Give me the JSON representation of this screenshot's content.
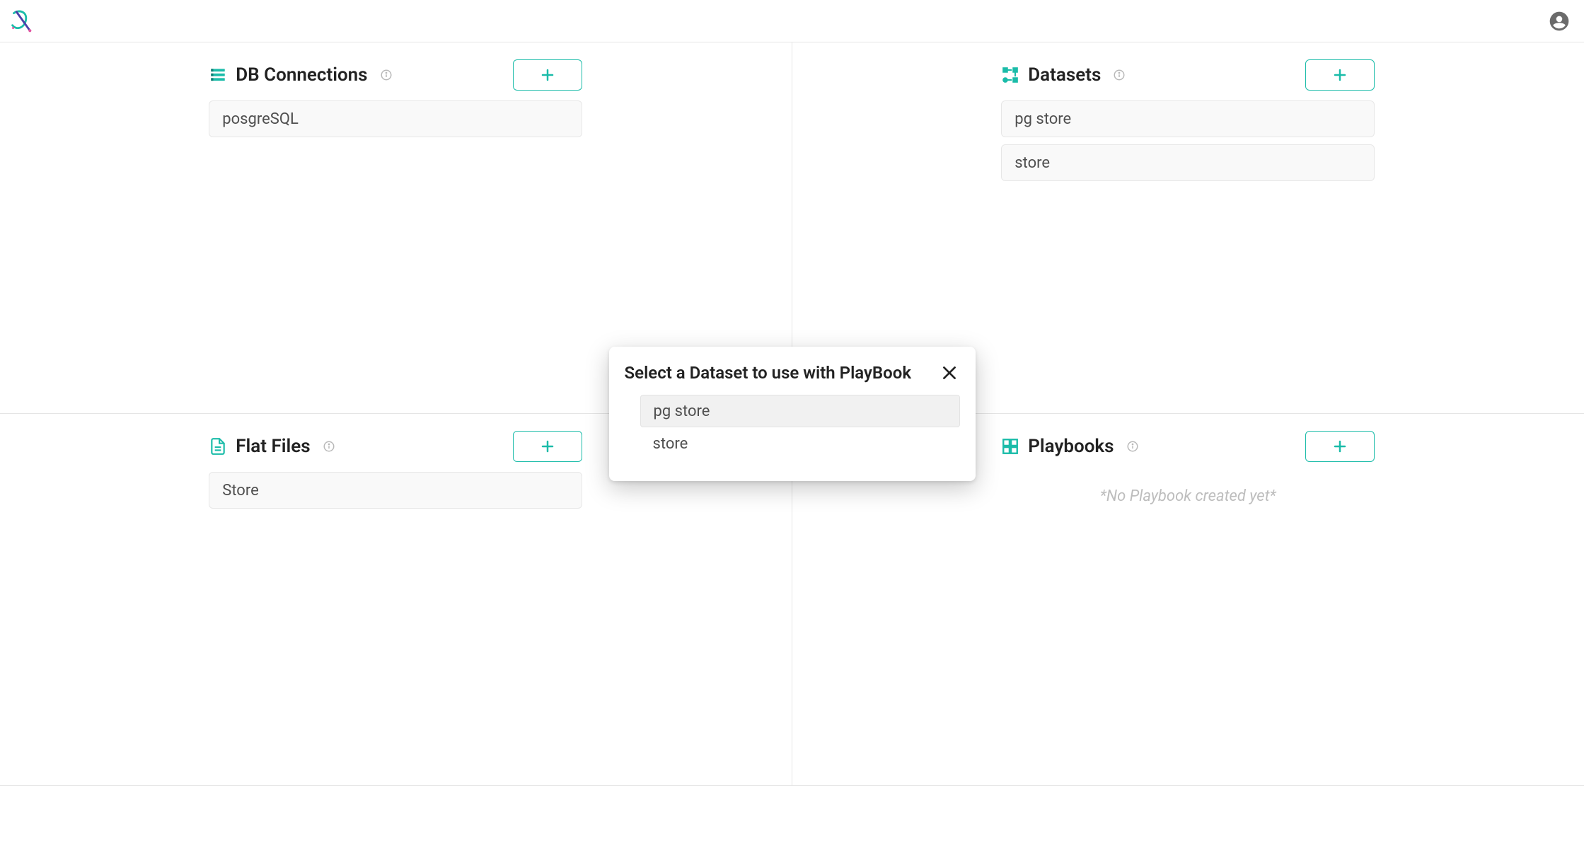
{
  "header": {},
  "sections": {
    "db_connections": {
      "title": "DB Connections",
      "items": [
        {
          "label": "posgreSQL"
        }
      ]
    },
    "datasets": {
      "title": "Datasets",
      "items": [
        {
          "label": "pg store"
        },
        {
          "label": "store"
        }
      ]
    },
    "flat_files": {
      "title": "Flat Files",
      "items": [
        {
          "label": "Store"
        }
      ]
    },
    "playbooks": {
      "title": "Playbooks",
      "empty_message": "*No Playbook created yet*"
    }
  },
  "modal": {
    "title": "Select a Dataset to use with PlayBook",
    "options": [
      {
        "label": "pg store",
        "highlighted": true
      },
      {
        "label": "store",
        "highlighted": false
      }
    ]
  }
}
